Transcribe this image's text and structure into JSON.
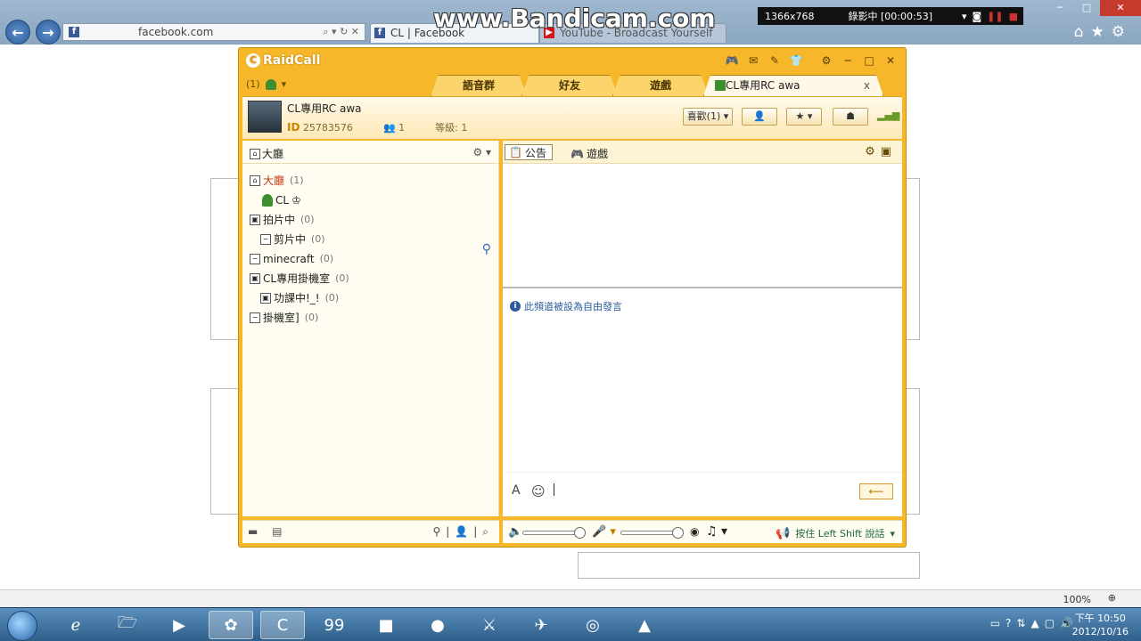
{
  "browser": {
    "address": "facebook.com",
    "tabs": [
      {
        "label": "CL | Facebook",
        "favicon": "f"
      },
      {
        "label": "YouTube - Broadcast Yourself",
        "favicon": "▶"
      }
    ]
  },
  "bandicam": {
    "watermark": "www.Bandicam.com",
    "resolution": "1366x768",
    "recording": "錄影中 [00:00:53]"
  },
  "raidcall": {
    "app_name": "RaidCall",
    "tabs": [
      {
        "label": "語音群"
      },
      {
        "label": "好友"
      },
      {
        "label": "遊戲"
      },
      {
        "label": "CL專用RC awa"
      }
    ],
    "channel": {
      "name": "CL專用RC awa",
      "id_label": "ID",
      "id_value": "25783576",
      "members": "1",
      "level": "等級: 1",
      "fav_label": "喜歡(1)"
    },
    "left": {
      "lobby_tab": "大廳",
      "tree": [
        {
          "label": "大廳",
          "count": "(1)"
        },
        {
          "label": "CL"
        },
        {
          "label": "拍片中",
          "count": "(0)"
        },
        {
          "label": "剪片中",
          "count": "(0)"
        },
        {
          "label": "minecraft",
          "count": "(0)"
        },
        {
          "label": "CL專用掛機室",
          "count": "(0)"
        },
        {
          "label": "功課中!_!",
          "count": "(0)"
        },
        {
          "label": "掛機室]",
          "count": "(0)"
        }
      ]
    },
    "right": {
      "announce_tab": "公告",
      "games_tab": "遊戲",
      "notice": "此頻道被設為自由發言",
      "ptt_label": "按住 Left Shift 說話"
    }
  },
  "zoom": "100%",
  "clock": {
    "time": "下午 10:50",
    "date": "2012/10/16"
  }
}
